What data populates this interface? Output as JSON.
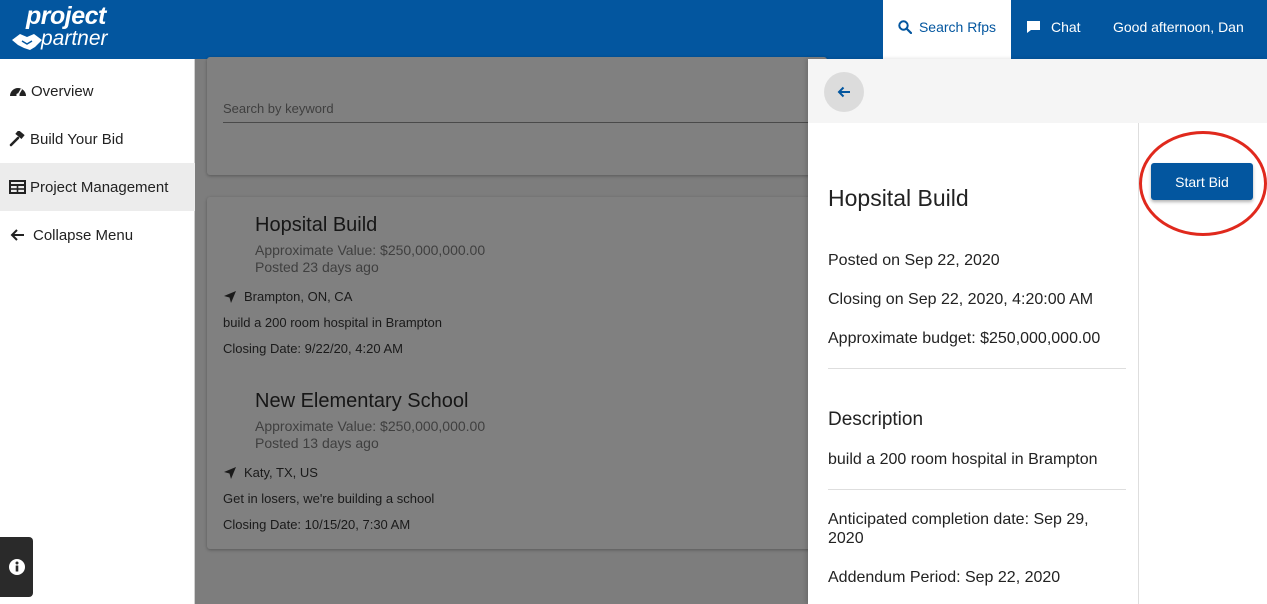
{
  "header": {
    "logo_line1": "project",
    "logo_line2": "partner",
    "search_rfps_label": "Search Rfps",
    "chat_label": "Chat",
    "greeting": "Good afternoon, Dan"
  },
  "sidebar": {
    "items": [
      {
        "label": "Overview",
        "icon": "dashboard-icon"
      },
      {
        "label": "Build Your Bid",
        "icon": "gavel-icon"
      },
      {
        "label": "Project Management",
        "icon": "table-icon",
        "active": true
      },
      {
        "label": "Collapse Menu",
        "icon": "arrow-left-icon"
      }
    ]
  },
  "search": {
    "placeholder": "Search by keyword",
    "value": ""
  },
  "rfps": [
    {
      "title": "Hopsital Build",
      "value": "Approximate Value: $250,000,000.00",
      "posted": "Posted 23 days ago",
      "location": "Brampton, ON, CA",
      "description": "build a 200 room hospital in Brampton",
      "closing": "Closing Date: 9/22/20, 4:20 AM"
    },
    {
      "title": "New Elementary School",
      "value": "Approximate Value: $250,000,000.00",
      "posted": "Posted 13 days ago",
      "location": "Katy, TX, US",
      "description": "Get in losers, we're building a school",
      "closing": "Closing Date: 10/15/20, 7:30 AM"
    }
  ],
  "detail": {
    "title": "Hopsital Build",
    "posted_on": "Posted on Sep 22, 2020",
    "closing_on": "Closing on Sep 22, 2020, 4:20:00 AM",
    "budget": "Approximate budget: $250,000,000.00",
    "description_heading": "Description",
    "description": "build a 200 room hospital in Brampton",
    "completion": "Anticipated completion date: Sep 29, 2020",
    "addendum": "Addendum Period: Sep 22, 2020",
    "start_bid_label": "Start Bid"
  },
  "colors": {
    "brand": "#03569f",
    "overlay": "#7d7d7d",
    "highlight_ring": "#e0291d"
  }
}
